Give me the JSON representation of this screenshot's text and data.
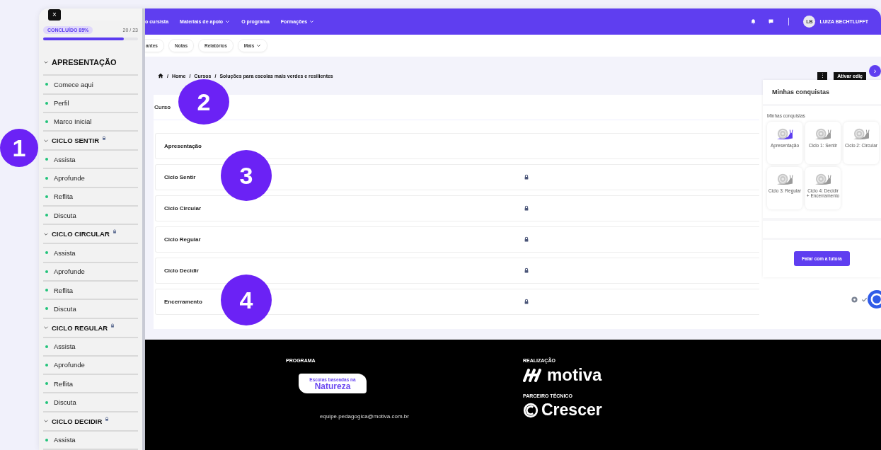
{
  "callouts": [
    "1",
    "2",
    "3",
    "4"
  ],
  "sidebar": {
    "close": "×",
    "progress": {
      "label": "CONCLUÍDO 85%",
      "count": "20 / 23",
      "level": 0.85
    },
    "sections": [
      {
        "title": "APRESENTAÇÃO",
        "expanded": true,
        "locked": false,
        "items": [
          {
            "label": "Comece aqui",
            "done": true
          },
          {
            "label": "Perfil",
            "done": true
          },
          {
            "label": "Marco Inicial",
            "done": true
          }
        ]
      },
      {
        "title": "CICLO SENTIR",
        "expanded": true,
        "locked": true,
        "items": [
          {
            "label": "Assista",
            "done": true
          },
          {
            "label": "Aprofunde",
            "done": true
          },
          {
            "label": "Reflita",
            "done": true
          },
          {
            "label": "Discuta",
            "done": true
          }
        ]
      },
      {
        "title": "CICLO CIRCULAR",
        "expanded": true,
        "locked": true,
        "items": [
          {
            "label": "Assista",
            "done": true
          },
          {
            "label": "Aprofunde",
            "done": true
          },
          {
            "label": "Reflita",
            "done": true
          },
          {
            "label": "Discuta",
            "done": true
          }
        ]
      },
      {
        "title": "CICLO REGULAR",
        "expanded": true,
        "locked": true,
        "items": [
          {
            "label": "Assista",
            "done": true
          },
          {
            "label": "Aprofunde",
            "done": true
          },
          {
            "label": "Reflita",
            "done": true
          },
          {
            "label": "Discuta",
            "done": true
          }
        ]
      },
      {
        "title": "CICLO DECIDIR",
        "expanded": true,
        "locked": true,
        "items": [
          {
            "label": "Assista",
            "done": true
          }
        ]
      }
    ]
  },
  "topnav": {
    "items": [
      {
        "label": "o cursista",
        "dropdown": false
      },
      {
        "label": "Materiais de apoio",
        "dropdown": true
      },
      {
        "label": "O programa",
        "dropdown": false
      },
      {
        "label": "Formações",
        "dropdown": true
      }
    ],
    "avatar": "LB",
    "user": "LUIZA BECHTLUFFT"
  },
  "subnav": [
    {
      "label": "antes",
      "dropdown": false
    },
    {
      "label": "Notas",
      "dropdown": false
    },
    {
      "label": "Relatórios",
      "dropdown": false
    },
    {
      "label": "Mais",
      "dropdown": true
    }
  ],
  "breadcrumb": {
    "separator": "/",
    "items": [
      "Home",
      "Cursos",
      "Soluções para escolas mais verdes e resilientes"
    ]
  },
  "actions": {
    "menu": "⋮",
    "edit": "Ativar ediç",
    "toggle": "›"
  },
  "course": {
    "heading": "Curso",
    "rows": [
      {
        "name": "Apresentação",
        "locked": false
      },
      {
        "name": "Ciclo Sentir",
        "locked": true
      },
      {
        "name": "Ciclo Circular",
        "locked": true
      },
      {
        "name": "Ciclo Regular",
        "locked": true
      },
      {
        "name": "Ciclo Decidir",
        "locked": true
      },
      {
        "name": "Encerramento",
        "locked": true
      }
    ]
  },
  "achievements": {
    "title": "Minhas conquistas",
    "subtitle": "Minhas conquistas",
    "badges": [
      {
        "label": "Apresentação",
        "earned": true
      },
      {
        "label": "Ciclo 1: Sentir",
        "earned": false
      },
      {
        "label": "Ciclo 2: Circular",
        "earned": false
      },
      {
        "label": "Ciclo 3: Regular",
        "earned": false
      },
      {
        "label": "Ciclo 4: Decidir + Encerramento",
        "earned": false
      }
    ],
    "button": "Falar com a tutora"
  },
  "footer": {
    "program_heading": "PROGRAMA",
    "program_logo_top": "Escolas baseadas na",
    "program_logo_main": "Natureza",
    "email": "equipe.pedagogica@motiva.com.br",
    "realization_heading": "REALIZAÇÃO",
    "realization_logo": "motiva",
    "partner_heading": "PARCEIRO TÉCNICO",
    "partner_logo": "Crescer"
  }
}
